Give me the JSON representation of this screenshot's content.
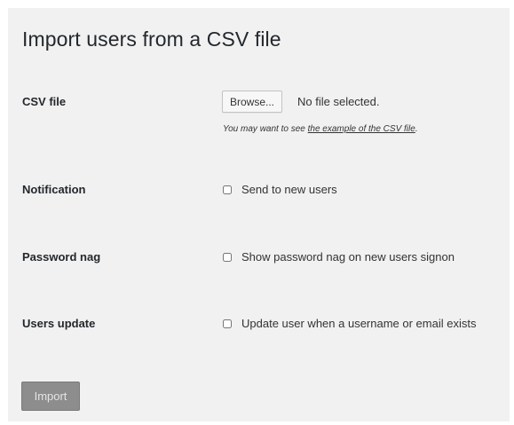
{
  "page": {
    "title": "Import users from a CSV file"
  },
  "csv_file": {
    "label": "CSV file",
    "browse_label": "Browse...",
    "status": "No file selected.",
    "hint_prefix": "You may want to see ",
    "hint_link": "the example of the CSV file",
    "hint_suffix": "."
  },
  "notification": {
    "label": "Notification",
    "option_label": "Send to new users",
    "checked": false
  },
  "password_nag": {
    "label": "Password nag",
    "option_label": "Show password nag on new users signon",
    "checked": false
  },
  "users_update": {
    "label": "Users update",
    "option_label": "Update user when a username or email exists",
    "checked": false
  },
  "actions": {
    "import_label": "Import"
  },
  "colors": {
    "panel_background": "#f1f1f1",
    "text": "#333333",
    "import_button": "#8d8d8d"
  }
}
